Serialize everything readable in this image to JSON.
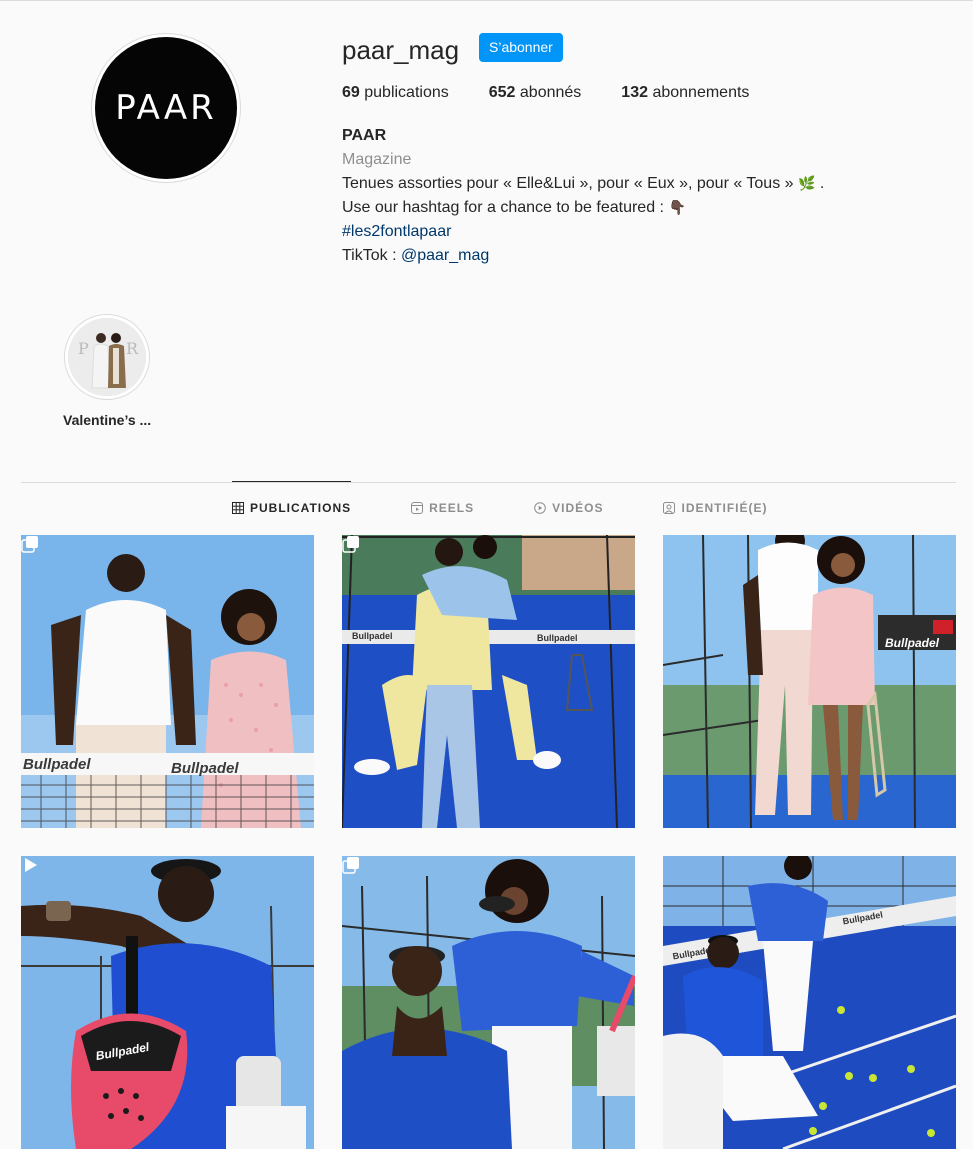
{
  "profile": {
    "username": "paar_mag",
    "follow_label": "S’abonner",
    "avatar_text": "PAAR",
    "stats": [
      {
        "count": "69",
        "label": "publications"
      },
      {
        "count": "652",
        "label": "abonnés"
      },
      {
        "count": "132",
        "label": "abonnements"
      }
    ],
    "bio": {
      "name": "PAAR",
      "category": "Magazine",
      "line1": "Tenues assorties pour « Elle&Lui », pour « Eux », pour « Tous »",
      "line1_emoji": "🌿",
      "line1_end": ".",
      "line2": "Use our hashtag for a chance to be featured :",
      "line2_emoji": "👇🏿",
      "hashtag": "#les2fontlapaar",
      "tiktok_prefix": "TikTok : ",
      "tiktok_handle": "@paar_mag"
    }
  },
  "highlights": [
    {
      "label": "Valentine’s ..."
    }
  ],
  "tabs": [
    {
      "label": "PUBLICATIONS",
      "icon": "grid-icon",
      "active": true
    },
    {
      "label": "REELS",
      "icon": "reels-icon",
      "active": false
    },
    {
      "label": "VIDÉOS",
      "icon": "video-icon",
      "active": false
    },
    {
      "label": "IDENTIFIÉ(E)",
      "icon": "tagged-icon",
      "active": false
    }
  ],
  "posts": [
    {
      "badge": "carousel-icon"
    },
    {
      "badge": "carousel-icon"
    },
    {
      "badge": ""
    },
    {
      "badge": "video-icon"
    },
    {
      "badge": "carousel-icon"
    },
    {
      "badge": ""
    }
  ],
  "colors": {
    "accent": "#0095f6",
    "link": "#00376b",
    "court_blue": "#1f4fc4",
    "sky": "#8fc4ef"
  }
}
